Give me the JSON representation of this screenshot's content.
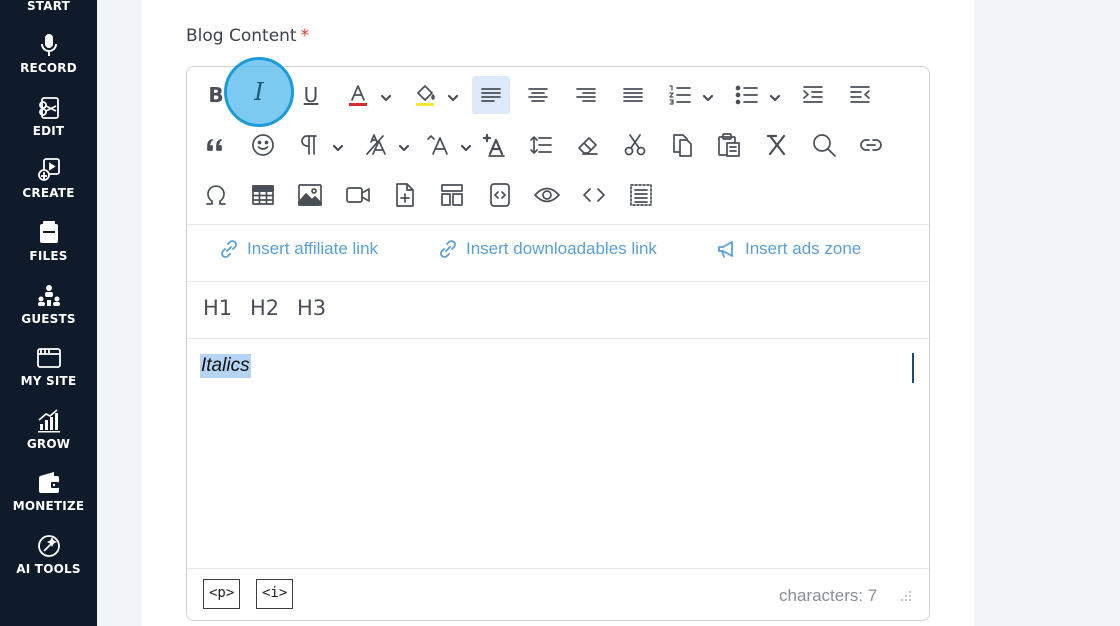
{
  "sidebar": {
    "items": [
      {
        "label": "START",
        "icon": "rocket-icon"
      },
      {
        "label": "RECORD",
        "icon": "microphone-icon"
      },
      {
        "label": "EDIT",
        "icon": "edit-icon"
      },
      {
        "label": "CREATE",
        "icon": "create-icon"
      },
      {
        "label": "FILES",
        "icon": "files-icon"
      },
      {
        "label": "GUESTS",
        "icon": "guests-icon"
      },
      {
        "label": "MY SITE",
        "icon": "site-icon"
      },
      {
        "label": "GROW",
        "icon": "grow-icon"
      },
      {
        "label": "MONETIZE",
        "icon": "wallet-icon"
      },
      {
        "label": "AI TOOLS",
        "icon": "ai-tools-icon"
      }
    ]
  },
  "field": {
    "label": "Blog Content",
    "required_mark": "*"
  },
  "toolbar": {
    "bold": "B",
    "italic": "I",
    "underline": "U",
    "font_color": "#d32f2f",
    "highlight_color": "#f5e53b",
    "active_color": "#dde9f8"
  },
  "insert_links": {
    "affiliate": "Insert affiliate link",
    "downloadables": "Insert downloadables link",
    "ads_zone": "Insert ads zone"
  },
  "headings": {
    "h1": "H1",
    "h2": "H2",
    "h3": "H3"
  },
  "content": {
    "text": "Italics"
  },
  "statusbar": {
    "path": [
      "<p>",
      "<i>"
    ],
    "characters": "characters: 7"
  },
  "colors": {
    "sidebar_bg": "#0f1a2a",
    "accent_link": "#5b9fd6",
    "selection": "#b5d3f3",
    "click_indicator": "#4ab6ec"
  }
}
